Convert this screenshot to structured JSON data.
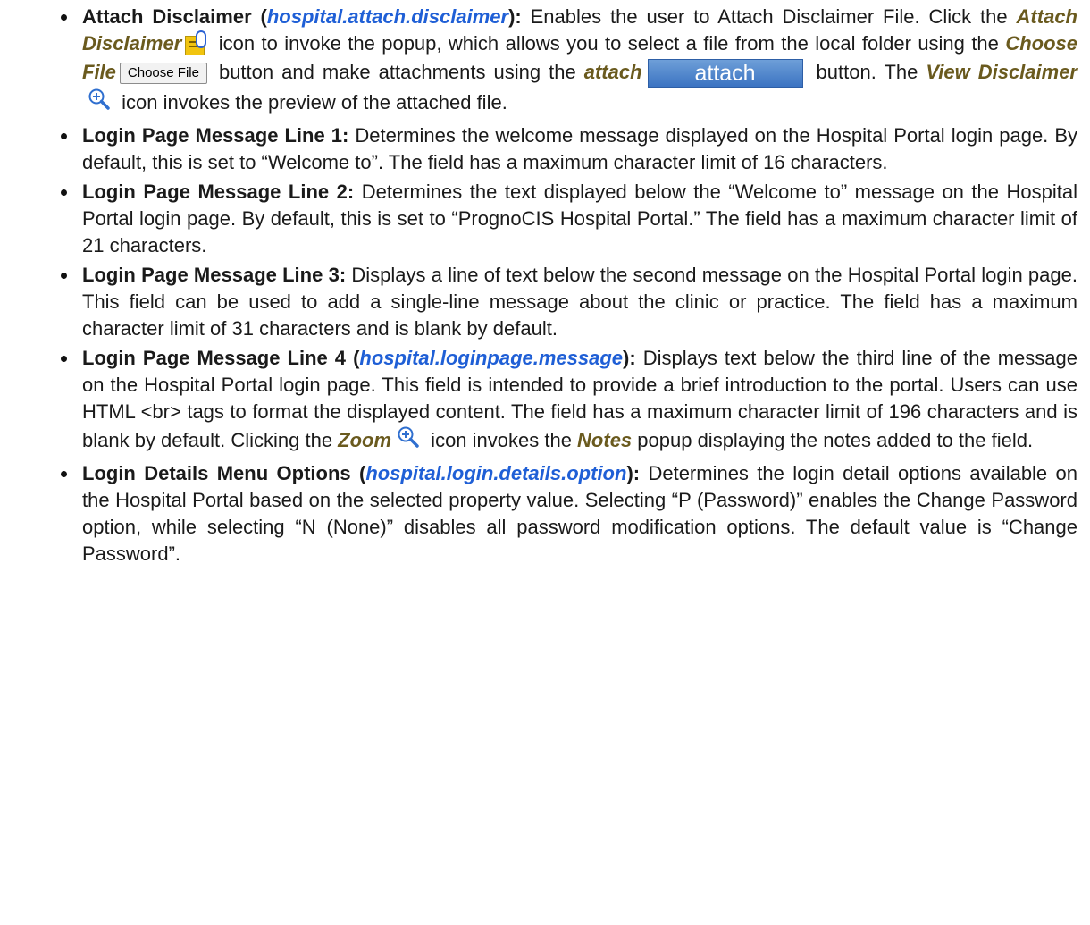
{
  "items": [
    {
      "term": "Attach Disclaimer (",
      "prop": "hospital.attach.disclaimer",
      "term_end": "):",
      "text1": " Enables the user to Attach Disclaimer File. Click the ",
      "ui1": "Attach Disclaimer",
      "text2": " icon to invoke the popup, which allows you to select a file from the local folder using the ",
      "ui2": "Choose File",
      "btn1": "Choose File",
      "text3": " button and make attachments using the ",
      "ui3": "attach",
      "btn2": "attach",
      "text4": " button. The ",
      "ui4": "View Disclaimer",
      "text5": " icon invokes the preview of the attached file."
    },
    {
      "term": "Login Page Message Line 1:",
      "text": " Determines the welcome message displayed on the Hospital Portal login page. By default, this is set to “Welcome to”. The field has a maximum character limit of 16 characters."
    },
    {
      "term": "Login Page Message Line 2:",
      "text": " Determines the text displayed below the “Welcome to” message on the Hospital Portal login page. By default, this is set to “PrognoCIS Hospital Portal.” The field has a maximum character limit of 21 characters."
    },
    {
      "term": "Login Page Message Line 3:",
      "text": " Displays a line of text below the second message on the Hospital Portal login page. This field can be used to add a single-line message about the clinic or practice. The field has a maximum character limit of 31 characters and is blank by default."
    },
    {
      "term": "Login Page Message Line 4 (",
      "prop": "hospital.loginpage.message",
      "term_end": "):",
      "text1": " Displays text below the third line of the message on the Hospital Portal login page. This field is intended to provide a brief introduction to the portal. Users can use HTML <br> tags to format the displayed content. The field has a maximum character limit of 196 characters and is blank by default. Clicking the ",
      "ui1": "Zoom",
      "text2": " icon invokes the ",
      "ui2": "Notes",
      "text3": " popup displaying the notes added to the field."
    },
    {
      "term": "Login Details Menu Options (",
      "prop": "hospital.login.details.option",
      "term_end": "):",
      "text": " Determines the login detail options available on the Hospital Portal based on the selected property value. Selecting “P (Password)” enables the Change Password option, while selecting “N (None)” disables all password modification options. The default value is “Change Password”."
    }
  ],
  "icons": {
    "attach_disclaimer": "attach-file-icon",
    "view_disclaimer": "zoom-in-icon",
    "zoom": "zoom-in-icon"
  },
  "colors": {
    "property": "#1f5fd6",
    "ui_term": "#6a5a1e",
    "attach_button": "#4a84cc"
  }
}
